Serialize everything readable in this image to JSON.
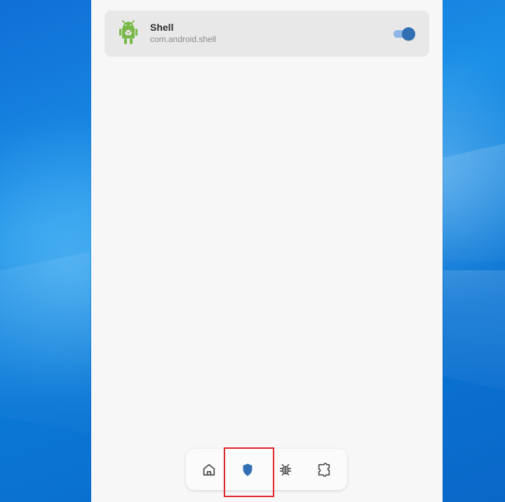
{
  "app_list": [
    {
      "name": "Shell",
      "package": "com.android.shell",
      "enabled": true
    }
  ],
  "bottom_nav": [
    {
      "name": "home",
      "icon": "home-icon",
      "active": false
    },
    {
      "name": "security",
      "icon": "shield-icon",
      "active": true
    },
    {
      "name": "debug",
      "icon": "bug-icon",
      "active": false
    },
    {
      "name": "extensions",
      "icon": "puzzle-icon",
      "active": false
    }
  ],
  "colors": {
    "accent": "#2f6fb2",
    "highlight": "#e1262d",
    "card": "#e8e8e8",
    "background": "#f7f7f7"
  }
}
